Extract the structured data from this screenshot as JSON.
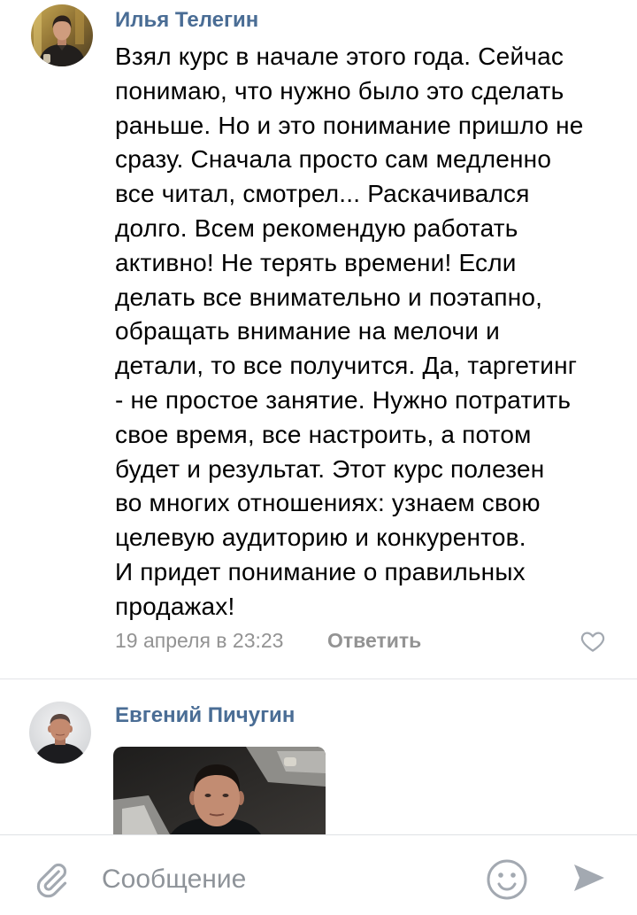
{
  "comments": [
    {
      "author": "Илья Телегин",
      "lines": [
        "Взял курс в начале этого года. Сейчас",
        "понимаю, что нужно было это сделать",
        "раньше. Но и это понимание пришло не",
        "сразу. Сначала просто сам медленно",
        "все читал, смотрел... Раскачивался",
        "долго. Всем рекомендую работать",
        "активно! Не терять времени! Если",
        "делать все внимательно и поэтапно,",
        "обращать внимание на мелочи и",
        "детали, то все получится. Да, таргетинг",
        "- не простое занятие. Нужно потратить",
        "свое время, все настроить, а потом",
        "будет и результат. Этот курс полезен",
        "во многих отношениях: узнаем свою",
        "целевую аудиторию и конкурентов.",
        "И придет понимание о правильных",
        "продажах!"
      ],
      "date": "19 апреля в 23:23",
      "reply_label": "Ответить",
      "like_icon": "heart-outline-icon"
    },
    {
      "author": "Евгений Пичугин"
    }
  ],
  "composer": {
    "placeholder": "Сообщение",
    "attach_icon": "paperclip-icon",
    "emoji_icon": "smiley-icon",
    "send_icon": "send-icon"
  },
  "colors": {
    "author_name": "#4a6d95",
    "text": "#000000",
    "secondary_text": "#939393",
    "placeholder": "#8e9399",
    "icon": "#a3a9b1",
    "divider": "#e3e4e8",
    "background": "#ffffff"
  }
}
